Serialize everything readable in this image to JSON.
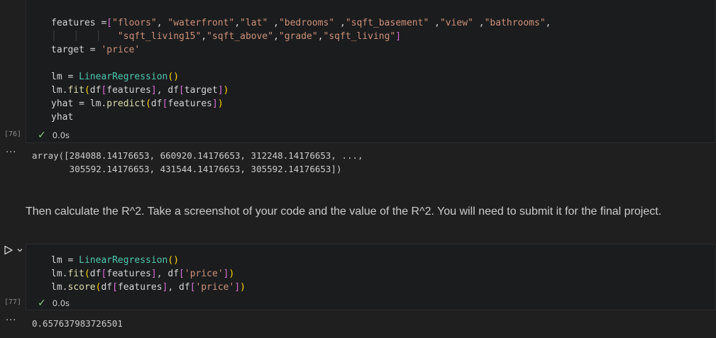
{
  "cells": [
    {
      "execution_count": "[76]",
      "status_icon": "check-icon",
      "status_time": "0.0s",
      "code_lines": [
        "features =[\"floors\", \"waterfront\",\"lat\" ,\"bedrooms\" ,\"sqft_basement\" ,\"view\" ,\"bathrooms\",",
        "            \"sqft_living15\",\"sqft_above\",\"grade\",\"sqft_living\"]",
        "target = 'price'",
        "",
        "lm = LinearRegression()",
        "lm.fit(df[features], df[target])",
        "yhat = lm.predict(df[features])",
        "yhat"
      ],
      "output_lines": [
        "array([284088.14176653, 660920.14176653, 312248.14176653, ...,",
        "       305592.14176653, 431544.14176653, 305592.14176653])"
      ]
    },
    {
      "markdown": "Then calculate the R^2. Take a screenshot of your code and the value of the R^2. You will need to submit it for the final project."
    },
    {
      "execution_count": "[77]",
      "status_icon": "check-icon",
      "status_time": "0.0s",
      "code_lines": [
        "lm = LinearRegression()",
        "lm.fit(df[features], df['price'])",
        "lm.score(df[features], df['price'])"
      ],
      "output_lines": [
        "0.657637983726501"
      ]
    }
  ],
  "output_ellipsis": "···",
  "run_icon": "play-icon",
  "run_menu_icon": "chevron-down-icon"
}
